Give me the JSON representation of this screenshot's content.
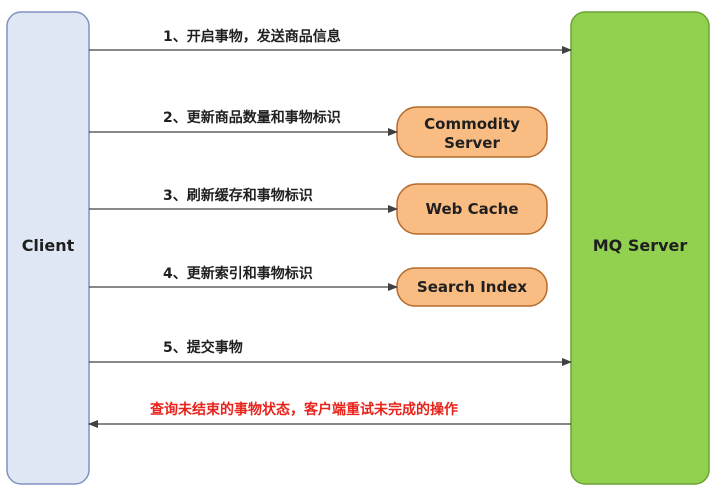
{
  "client": {
    "label": "Client"
  },
  "mq_server": {
    "label": "MQ Server"
  },
  "services": {
    "commodity_line1": "Commodity",
    "commodity_line2": "Server",
    "web_cache": "Web Cache",
    "search_index": "Search Index"
  },
  "steps": {
    "step1": "1、开启事物，发送商品信息",
    "step2": "2、更新商品数量和事物标识",
    "step3": "3、刷新缓存和事物标识",
    "step4": "4、更新索引和事物标识",
    "step5": "5、提交事物",
    "status_check": "查询未结束的事物状态，客户端重试未完成的操作"
  },
  "colors": {
    "client_fill": "#dfe6f4",
    "client_stroke": "#7e93c0",
    "mq_fill": "#92d050",
    "mq_stroke": "#6aa236",
    "service_fill": "#f9bd84",
    "service_stroke": "#b56a2c",
    "arrow": "#404040",
    "status_text": "#e8231b"
  }
}
